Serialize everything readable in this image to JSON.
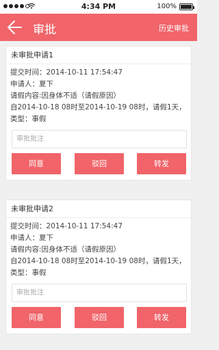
{
  "status_bar": {
    "time": "4:34 PM",
    "battery": "100%"
  },
  "navbar": {
    "title": "审批",
    "history_label": "历史审批",
    "accent_color": "#f0646a"
  },
  "cards": [
    {
      "title": "未审批申请1",
      "submit_time": "提交时间：2014-10-11 17:54:47",
      "applicant": "申请人：夏下",
      "content": "请假内容:因身体不适（请假原因）",
      "period": "自2014-10-18 08时至2014-10-19 08时，请假1天，",
      "type": "类型：事假",
      "note_placeholder": "审批批注",
      "buttons": {
        "approve": "同意",
        "reject": "驳回",
        "forward": "转发"
      }
    },
    {
      "title": "未审批申请2",
      "submit_time": "提交时间：2014-10-11 17:54:47",
      "applicant": "申请人：夏下",
      "content": "请假内容:因身体不适（请假原因）",
      "period": "自2014-10-18 08时至2014-10-19 08时，请假1天，",
      "type": "类型：事假",
      "note_placeholder": "审批批注",
      "buttons": {
        "approve": "同意",
        "reject": "驳回",
        "forward": "转发"
      }
    }
  ]
}
